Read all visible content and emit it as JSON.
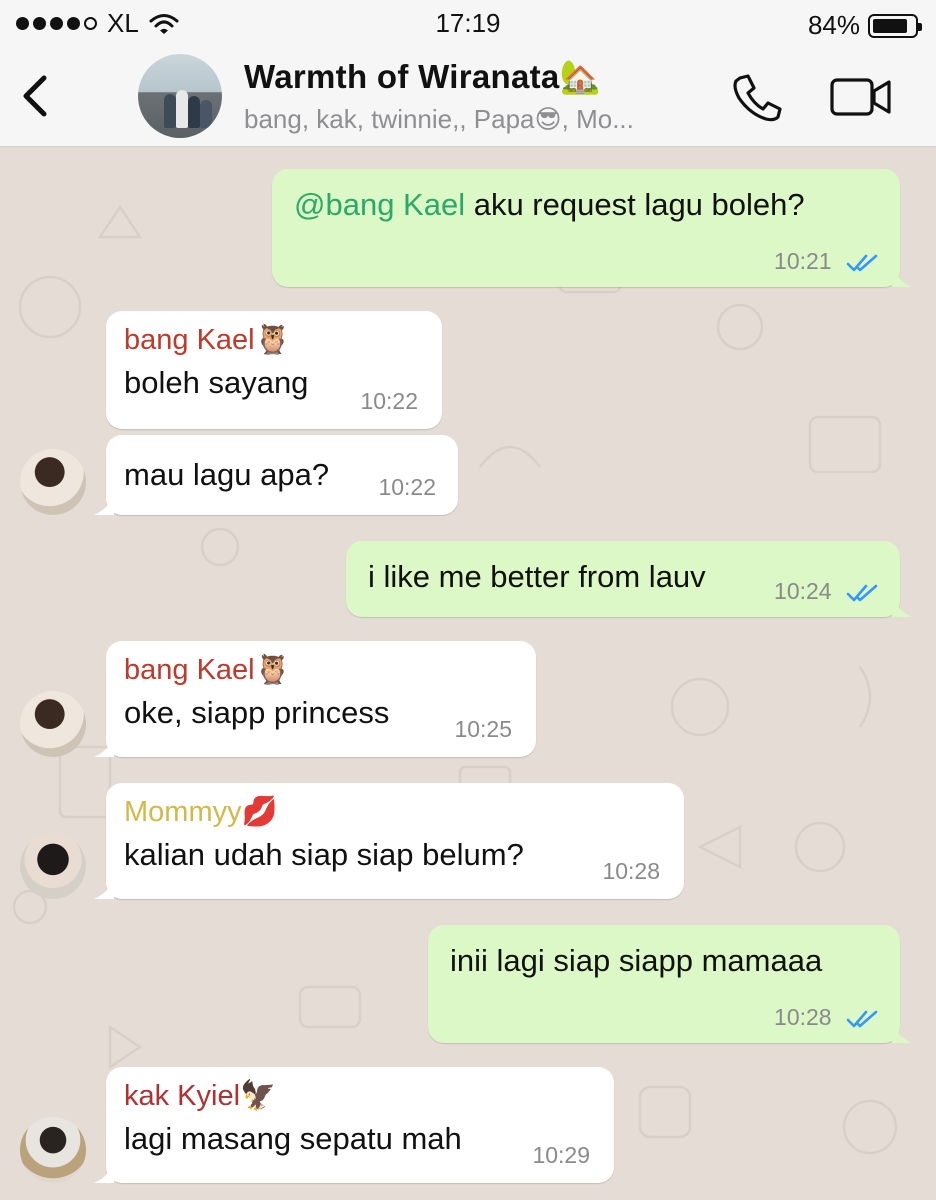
{
  "status_bar": {
    "carrier": "XL",
    "time": "17:19",
    "battery_percent": "84%",
    "battery_level": 0.84,
    "signal_bars_filled": 4
  },
  "header": {
    "title": "Warmth of Wiranata🏡",
    "subtitle": "bang, kak, twinnie,, Papa😎, Mo..."
  },
  "icons": {
    "back": "chevron-left-icon",
    "call": "phone-icon",
    "video": "video-camera-icon",
    "read": "double-check-icon"
  },
  "colors": {
    "outgoing_bubble": "#dcf8c6",
    "incoming_bubble": "#ffffff",
    "mention": "#2aa968",
    "sender_bang_kael": "#c0392b",
    "sender_mommyy": "#d4b84a",
    "sender_kak_kyiel": "#b03030",
    "read_ticks": "#3497f9",
    "chat_background": "#e5ddd5"
  },
  "messages": [
    {
      "direction": "out",
      "mention": "@bang Kael",
      "text": " aku request lagu boleh?",
      "time": "10:21",
      "read": true
    },
    {
      "direction": "in",
      "sender": "bang Kael🦉",
      "text": "boleh sayang",
      "time": "10:22"
    },
    {
      "direction": "in",
      "text": "mau lagu apa?",
      "time": "10:22"
    },
    {
      "direction": "out",
      "text": "i like me better from lauv",
      "time": "10:24",
      "read": true
    },
    {
      "direction": "in",
      "sender": "bang Kael🦉",
      "text": "oke, siapp princess",
      "time": "10:25"
    },
    {
      "direction": "in",
      "sender": "Mommyy💋",
      "text": "kalian udah siap siap belum?",
      "time": "10:28"
    },
    {
      "direction": "out",
      "text": "inii lagi siap siapp mamaaa",
      "time": "10:28",
      "read": true
    },
    {
      "direction": "in",
      "sender": "kak Kyiel🦅",
      "text": "lagi masang sepatu mah",
      "time": "10:29"
    }
  ]
}
